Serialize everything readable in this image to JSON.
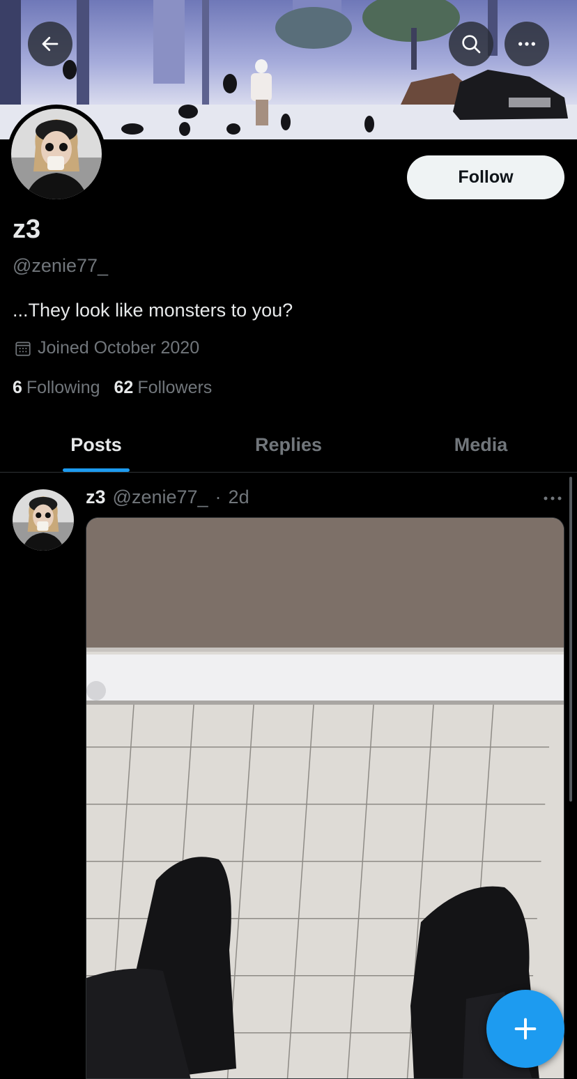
{
  "header": {
    "back_icon": "arrow-left-icon",
    "search_icon": "search-icon",
    "more_icon": "more-horizontal-icon"
  },
  "profile": {
    "display_name": "z3",
    "handle": "@zenie77_",
    "bio": "...They look like monsters to you?",
    "joined": "Joined October 2020",
    "joined_icon": "calendar-icon",
    "following_count": "6",
    "following_label": "Following",
    "followers_count": "62",
    "followers_label": "Followers",
    "follow_label": "Follow"
  },
  "tabs": [
    {
      "label": "Posts",
      "active": true
    },
    {
      "label": "Replies",
      "active": false
    },
    {
      "label": "Media",
      "active": false
    }
  ],
  "post": {
    "name": "z3",
    "handle": "@zenie77_",
    "separator": "·",
    "time": "2d",
    "more_icon": "more-horizontal-icon"
  },
  "fab": {
    "icon": "plus-icon"
  },
  "colors": {
    "accent": "#1d9bf0",
    "background": "#000000",
    "text_primary": "#e7e9ea",
    "text_secondary": "#71767b"
  }
}
